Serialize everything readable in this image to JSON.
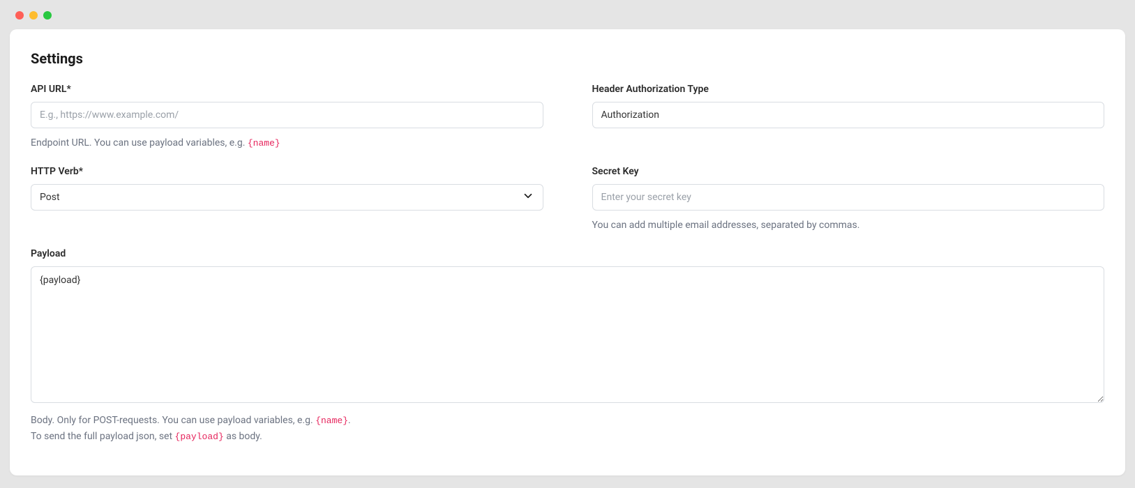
{
  "title": "Settings",
  "api_url": {
    "label": "API URL*",
    "placeholder": "E.g., https://www.example.com/",
    "helper_prefix": "Endpoint URL. You can use payload variables, e.g. ",
    "helper_code": "{name}"
  },
  "header_auth": {
    "label": "Header Authorization Type",
    "value": "Authorization"
  },
  "http_verb": {
    "label": "HTTP Verb*",
    "value": "Post"
  },
  "secret_key": {
    "label": "Secret Key",
    "placeholder": "Enter your secret key",
    "helper": "You can add multiple email addresses, separated by commas."
  },
  "payload": {
    "label": "Payload",
    "value": "{payload}",
    "helper_line1_prefix": "Body. Only for POST-requests. You can use payload variables, e.g. ",
    "helper_line1_code": "{name}",
    "helper_line1_suffix": ".",
    "helper_line2_prefix": "To send the full payload json, set ",
    "helper_line2_code": "{payload}",
    "helper_line2_suffix": " as body."
  }
}
